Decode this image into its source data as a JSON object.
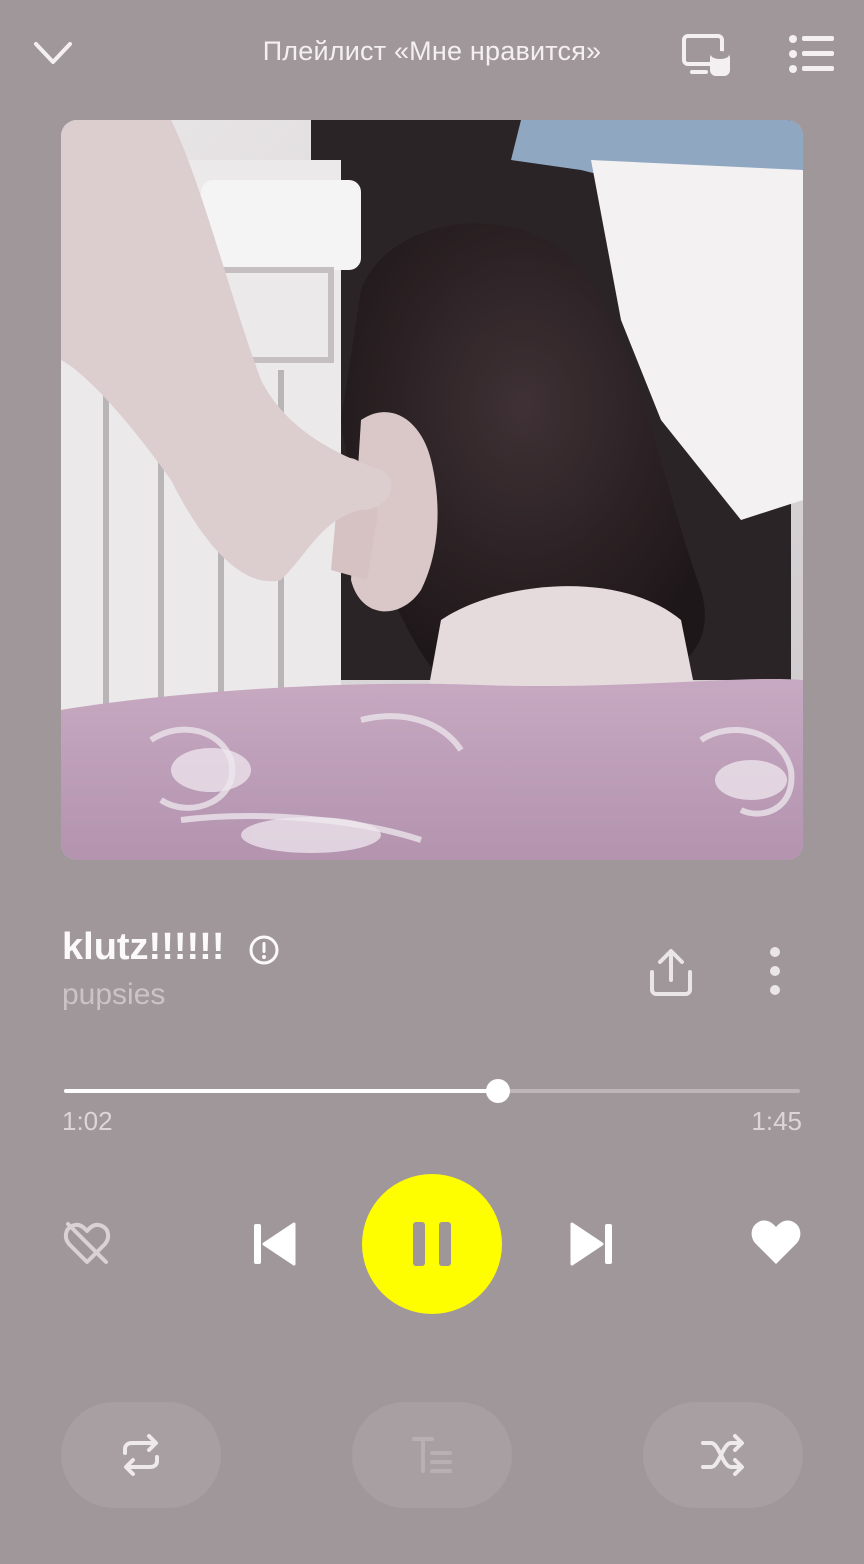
{
  "header": {
    "title": "Плейлист «Мне нравится»"
  },
  "track": {
    "title": "klutz!!!!!!",
    "artist": "pupsies",
    "explicit": true
  },
  "playback": {
    "elapsed": "1:02",
    "total": "1:45",
    "progress": 0.59,
    "state": "playing"
  },
  "icons": {
    "collapse": "chevron-down-icon",
    "cast": "cast-device-icon",
    "queue": "queue-list-icon",
    "explicit": "explicit-icon",
    "share": "share-icon",
    "more": "more-vertical-icon",
    "dislike": "dislike-icon",
    "prev": "skip-previous-icon",
    "pause": "pause-icon",
    "next": "skip-next-icon",
    "like": "heart-icon",
    "repeat": "repeat-icon",
    "lyrics": "lyrics-icon",
    "shuffle": "shuffle-icon"
  },
  "colors": {
    "background": "#a0979a",
    "accent": "#fffe00",
    "text": "#ffffff"
  }
}
